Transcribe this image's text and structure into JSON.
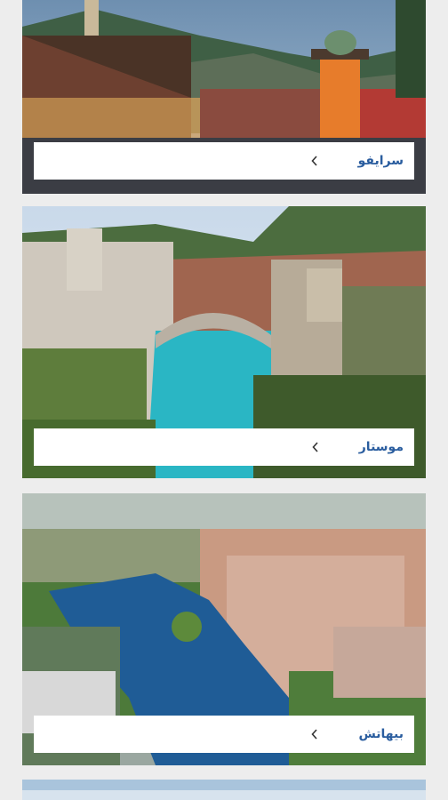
{
  "cities": [
    {
      "name": "سرايفو",
      "chevron_icon": "chevron-left-icon"
    },
    {
      "name": "موستار",
      "chevron_icon": "chevron-left-icon"
    },
    {
      "name": "بيهاتش",
      "chevron_icon": "chevron-left-icon"
    }
  ],
  "colors": {
    "page_background": "#ededed",
    "label_background": "#ffffff",
    "city_text": "#2a5d9f",
    "chevron": "#333333"
  }
}
